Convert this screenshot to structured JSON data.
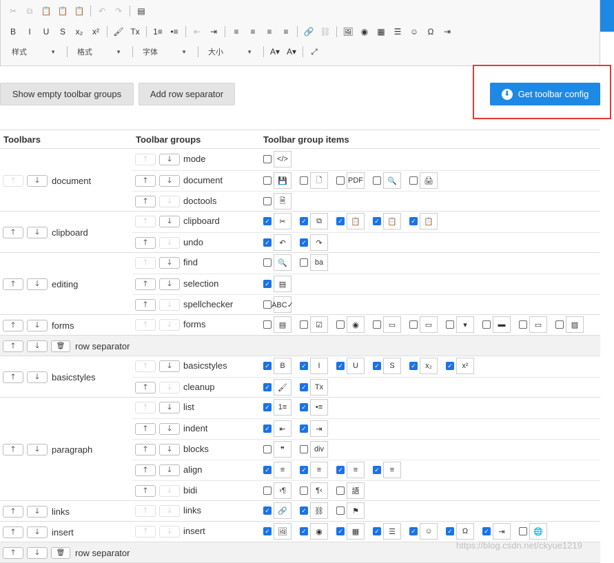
{
  "editor_toolbar": {
    "row1": [
      [
        "cut-icon",
        "✂",
        1
      ],
      [
        "copy-icon",
        "⧉",
        1
      ],
      [
        "paste-icon",
        "📋",
        0
      ],
      [
        "paste-text-icon",
        "📋",
        0
      ],
      [
        "paste-word-icon",
        "📋",
        0
      ],
      "|",
      [
        "undo-icon",
        "↶",
        1
      ],
      [
        "redo-icon",
        "↷",
        1
      ],
      "|",
      [
        "select-all-icon",
        "▤",
        0
      ]
    ],
    "row2": [
      [
        "bold-icon",
        "B",
        0
      ],
      [
        "italic-icon",
        "I",
        0
      ],
      [
        "underline-icon",
        "U",
        0
      ],
      [
        "strike-icon",
        "S",
        0
      ],
      [
        "subscript-icon",
        "x₂",
        0
      ],
      [
        "superscript-icon",
        "x²",
        0
      ],
      "|",
      [
        "copy-format-icon",
        "🖌",
        0
      ],
      [
        "remove-format-icon",
        "Tx",
        0
      ],
      "|",
      [
        "numbered-list-icon",
        "1≡",
        0
      ],
      [
        "bulleted-list-icon",
        "•≡",
        0
      ],
      "|",
      [
        "outdent-icon",
        "⇤",
        1
      ],
      [
        "indent-icon",
        "⇥",
        0
      ],
      "|",
      [
        "align-left-icon",
        "≡",
        0
      ],
      [
        "align-center-icon",
        "≡",
        0
      ],
      [
        "align-right-icon",
        "≡",
        0
      ],
      [
        "justify-icon",
        "≡",
        0
      ],
      "|",
      [
        "link-icon",
        "🔗",
        0
      ],
      [
        "unlink-icon",
        "⛓",
        1
      ],
      "|",
      [
        "image-icon",
        "🖼",
        0
      ],
      [
        "flash-icon",
        "◉",
        0
      ],
      [
        "table-icon",
        "▦",
        0
      ],
      [
        "hr-icon",
        "☰",
        0
      ],
      [
        "smiley-icon",
        "☺",
        0
      ],
      [
        "special-char-icon",
        "Ω",
        0
      ],
      [
        "page-break-icon",
        "⇥",
        0
      ]
    ],
    "combos": [
      "样式",
      "格式",
      "字体",
      "大小"
    ],
    "text_color_label": "A",
    "bg_color_label": "A",
    "maximize_icon": "⤢"
  },
  "buttons": {
    "show_empty": "Show empty toolbar groups",
    "add_separator": "Add row separator",
    "get_config": "Get toolbar config"
  },
  "table_headers": [
    "Toolbars",
    "Toolbar groups",
    "Toolbar group items"
  ],
  "toolbars": [
    {
      "name": "document",
      "up": false,
      "down": true,
      "groups": [
        {
          "name": "mode",
          "up": false,
          "down": true,
          "items": [
            [
              0,
              "</>"
            ]
          ]
        },
        {
          "name": "document",
          "up": true,
          "down": true,
          "items": [
            [
              0,
              "💾"
            ],
            [
              0,
              "🗋"
            ],
            [
              0,
              "PDF"
            ],
            [
              0,
              "🔍"
            ],
            [
              0,
              "🖨"
            ]
          ]
        },
        {
          "name": "doctools",
          "up": true,
          "down": false,
          "items": [
            [
              0,
              "🗎"
            ]
          ]
        }
      ]
    },
    {
      "name": "clipboard",
      "up": true,
      "down": true,
      "groups": [
        {
          "name": "clipboard",
          "up": false,
          "down": true,
          "items": [
            [
              1,
              "✂"
            ],
            [
              1,
              "⧉"
            ],
            [
              1,
              "📋"
            ],
            [
              1,
              "📋"
            ],
            [
              1,
              "📋"
            ]
          ]
        },
        {
          "name": "undo",
          "up": true,
          "down": false,
          "items": [
            [
              1,
              "↶"
            ],
            [
              1,
              "↷"
            ]
          ]
        }
      ]
    },
    {
      "name": "editing",
      "up": true,
      "down": true,
      "groups": [
        {
          "name": "find",
          "up": false,
          "down": true,
          "items": [
            [
              0,
              "🔍"
            ],
            [
              0,
              "ba"
            ]
          ]
        },
        {
          "name": "selection",
          "up": true,
          "down": true,
          "items": [
            [
              1,
              "▤"
            ]
          ]
        },
        {
          "name": "spellchecker",
          "up": true,
          "down": false,
          "items": [
            [
              0,
              "ABC✓"
            ]
          ]
        }
      ]
    },
    {
      "name": "forms",
      "up": true,
      "down": true,
      "groups": [
        {
          "name": "forms",
          "up": false,
          "down": false,
          "items": [
            [
              0,
              "▤"
            ],
            [
              0,
              "☑"
            ],
            [
              0,
              "◉"
            ],
            [
              0,
              "▭"
            ],
            [
              0,
              "▭"
            ],
            [
              0,
              "▾"
            ],
            [
              0,
              "▬"
            ],
            [
              0,
              "▭"
            ],
            [
              0,
              "▨"
            ]
          ]
        }
      ]
    },
    {
      "separator": true,
      "label": "row separator"
    },
    {
      "name": "basicstyles",
      "up": true,
      "down": true,
      "groups": [
        {
          "name": "basicstyles",
          "up": false,
          "down": true,
          "items": [
            [
              1,
              "B"
            ],
            [
              1,
              "I"
            ],
            [
              1,
              "U"
            ],
            [
              1,
              "S"
            ],
            [
              1,
              "x₂"
            ],
            [
              1,
              "x²"
            ]
          ]
        },
        {
          "name": "cleanup",
          "up": true,
          "down": false,
          "items": [
            [
              1,
              "🖌"
            ],
            [
              1,
              "Tx"
            ]
          ]
        }
      ]
    },
    {
      "name": "paragraph",
      "up": true,
      "down": true,
      "groups": [
        {
          "name": "list",
          "up": false,
          "down": true,
          "items": [
            [
              1,
              "1≡"
            ],
            [
              1,
              "•≡"
            ]
          ]
        },
        {
          "name": "indent",
          "up": true,
          "down": true,
          "items": [
            [
              1,
              "⇤"
            ],
            [
              1,
              "⇥"
            ]
          ]
        },
        {
          "name": "blocks",
          "up": true,
          "down": true,
          "items": [
            [
              0,
              "❞"
            ],
            [
              0,
              "div"
            ]
          ]
        },
        {
          "name": "align",
          "up": true,
          "down": true,
          "items": [
            [
              1,
              "≡"
            ],
            [
              1,
              "≡"
            ],
            [
              1,
              "≡"
            ],
            [
              1,
              "≡"
            ]
          ]
        },
        {
          "name": "bidi",
          "up": true,
          "down": false,
          "items": [
            [
              0,
              "›¶"
            ],
            [
              0,
              "¶‹"
            ],
            [
              0,
              "語"
            ]
          ]
        }
      ]
    },
    {
      "name": "links",
      "up": true,
      "down": true,
      "groups": [
        {
          "name": "links",
          "up": false,
          "down": false,
          "items": [
            [
              1,
              "🔗"
            ],
            [
              1,
              "⛓"
            ],
            [
              0,
              "⚑"
            ]
          ]
        }
      ]
    },
    {
      "name": "insert",
      "up": true,
      "down": true,
      "groups": [
        {
          "name": "insert",
          "up": false,
          "down": false,
          "items": [
            [
              1,
              "🖼"
            ],
            [
              1,
              "◉"
            ],
            [
              1,
              "▦"
            ],
            [
              1,
              "☰"
            ],
            [
              1,
              "☺"
            ],
            [
              1,
              "Ω"
            ],
            [
              1,
              "⇥"
            ],
            [
              0,
              "🌐"
            ]
          ]
        }
      ]
    },
    {
      "separator": true,
      "label": "row separator"
    }
  ],
  "watermark": "https://blog.csdn.net/ckyue1219"
}
